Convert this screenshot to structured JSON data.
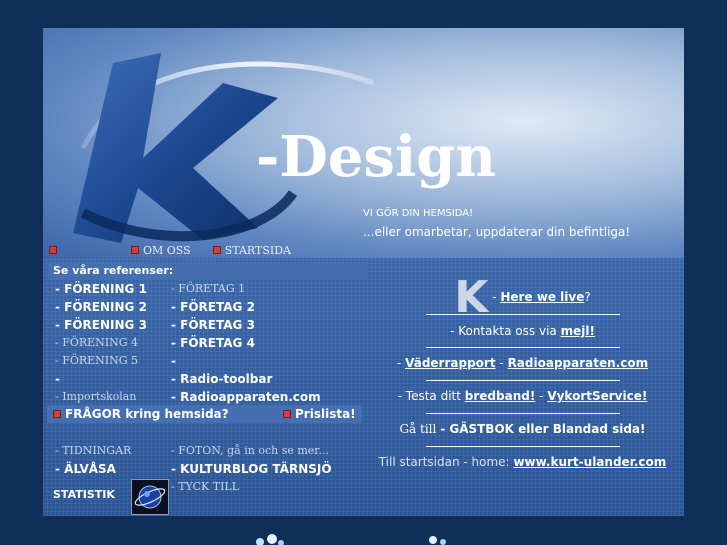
{
  "header": {
    "logo_word": "-Design",
    "tagline": "VI GÖR DIN HEMSIDA!",
    "subtagline": "...eller omarbetar, uppdaterar din befintliga!"
  },
  "nav": [
    {
      "label": ""
    },
    {
      "label": "OM OSS"
    },
    {
      "label": "STARTSIDA"
    }
  ],
  "refs_title": "Se våra referenser:",
  "col_forening": [
    "- FÖRENING 1",
    "- FÖRENING 2",
    "- FÖRENING 3",
    "- FÖRENING 4",
    "- FÖRENING 5",
    "-",
    "- Importskolan"
  ],
  "col_foretag": [
    "- FÖRETAG 1",
    "- FÖRETAG 2",
    "- FÖRETAG 3",
    "- FÖRETAG 4",
    "-",
    "- Radio-toolbar",
    "- Radioapparaten.com"
  ],
  "questions": {
    "left": "FRÅGOR kring hemsida?",
    "right": "Prislista!"
  },
  "col_lower_left": [
    "- TIDNINGAR",
    "- ÄLVÅSA"
  ],
  "col_lower_right": [
    "- FOTON, gå in och se mer...",
    "- KULTURBLOG TÄRNSJÖ",
    "- TYCK TILL"
  ],
  "statistik": "STATISTIK",
  "right": {
    "k_letter": "K",
    "here_prefix": "-",
    "here_link": "Here we live",
    "here_suffix": "?",
    "contact_prefix": "- Kontakta oss via",
    "contact_link": "mejl!",
    "weather_prefix": "-",
    "weather_link": "Väderrapport",
    "weather_mid": "-",
    "radio_link": "Radioapparaten.com",
    "test_prefix": "- Testa ditt",
    "test_link": "bredband!",
    "test_mid": "-",
    "vykort_link": "VykortService!",
    "guest_prefix": "Gå till",
    "guest_text": "- GÄSTBOK eller Blandad sida!",
    "home_prefix": "Till startsidan - home:",
    "home_link": "www.kurt-ulander.com"
  },
  "colors": {
    "page_bg": "#0f2f59",
    "panel": "#2f5c9e",
    "bar": "#466fb1",
    "bullet": "#d43b3b"
  }
}
